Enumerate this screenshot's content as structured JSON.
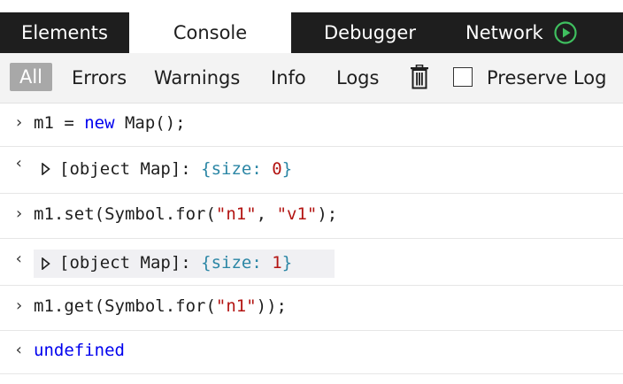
{
  "tabs": [
    {
      "label": "Elements",
      "active": false
    },
    {
      "label": "Console",
      "active": true
    },
    {
      "label": "Debugger",
      "active": false
    },
    {
      "label": "Network",
      "active": false
    }
  ],
  "filters": {
    "all": "All",
    "errors": "Errors",
    "warnings": "Warnings",
    "info": "Info",
    "logs": "Logs",
    "preserve_log": "Preserve Log",
    "preserve_log_checked": false,
    "active": "All"
  },
  "console": {
    "input_prompt": "›",
    "output_prompt": "‹",
    "rows": [
      {
        "kind": "input",
        "parts": [
          "m1 = ",
          "new",
          " Map();"
        ]
      },
      {
        "kind": "output",
        "parts": [
          "[object Map]: ",
          "{",
          "size: ",
          "0",
          "}"
        ]
      },
      {
        "kind": "input",
        "parts": [
          "m1.set(Symbol.for(",
          "\"n1\"",
          ", ",
          "\"v1\"",
          ");"
        ]
      },
      {
        "kind": "output",
        "parts": [
          "[object Map]: ",
          "{",
          "size: ",
          "1",
          "}"
        ]
      },
      {
        "kind": "input",
        "parts": [
          "m1.get(Symbol.for(",
          "\"n1\"",
          "));"
        ]
      },
      {
        "kind": "output",
        "parts": [
          "undefined"
        ]
      }
    ]
  },
  "colors": {
    "tabbar_bg": "#1e1e1e",
    "keyword": "#0000ee",
    "string": "#b31412",
    "number": "#b31412",
    "brace": "#2b86a5",
    "active_filter_bg": "#a8a8a8",
    "play_icon": "#3fbf5f"
  }
}
